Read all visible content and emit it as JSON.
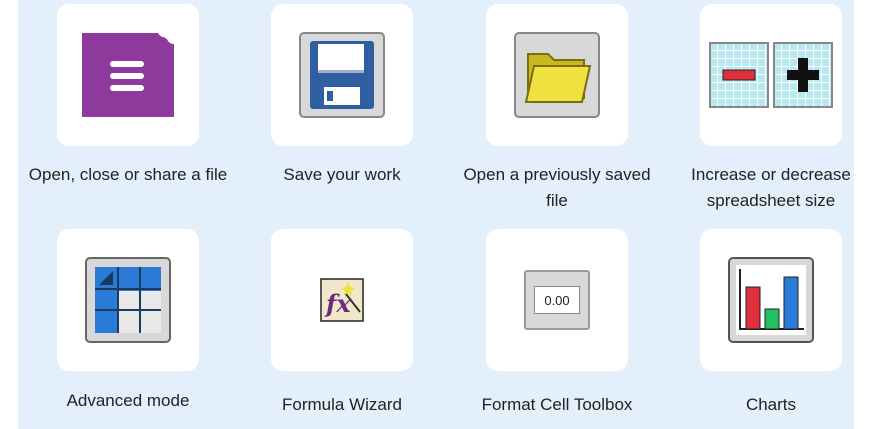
{
  "tools": [
    {
      "label": "Open, close or share a file",
      "icon": "file-menu-icon"
    },
    {
      "label": "Save your work",
      "icon": "floppy-disk-icon"
    },
    {
      "label": "Open a previously saved file",
      "icon": "folder-icon"
    },
    {
      "label": "Increase or decrease spreadsheet size",
      "icon": "resize-grid-icon"
    },
    {
      "label": "Advanced mode",
      "icon": "advanced-table-icon"
    },
    {
      "label": "Formula Wizard",
      "icon": "formula-wizard-icon"
    },
    {
      "label": "Format Cell Toolbox",
      "icon": "format-cell-icon"
    },
    {
      "label": "Charts",
      "icon": "bar-chart-icon"
    }
  ],
  "format_cell_value": "0.00",
  "colors": {
    "panel": "#e3f0fb",
    "file_menu": "#8e3a9d",
    "folder": "#f0e040",
    "chart_red": "#e0303c",
    "chart_green": "#22c060",
    "chart_blue": "#2a7ad8"
  }
}
